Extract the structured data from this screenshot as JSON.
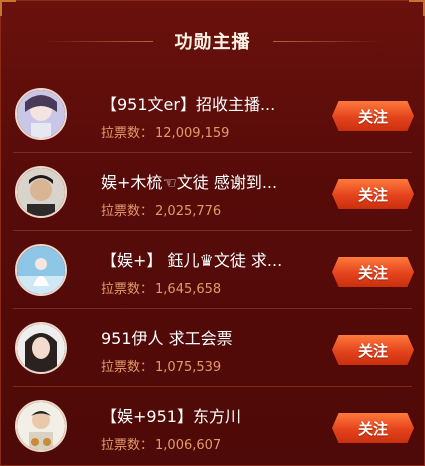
{
  "header": {
    "title": "功勋主播"
  },
  "accent": "#e4431c",
  "hosts": [
    {
      "name": "【951文er】招收主播...",
      "vote_label": "拉票数：",
      "votes": "12,009,159",
      "follow_label": "关注"
    },
    {
      "name": "娱+木梳☜文徒 感谢到...",
      "vote_label": "拉票数：",
      "votes": "2,025,776",
      "follow_label": "关注"
    },
    {
      "name": "【娱+】 鈺儿♛文徒 求...",
      "vote_label": "拉票数：",
      "votes": "1,645,658",
      "follow_label": "关注"
    },
    {
      "name": "951伊人 求工会票",
      "vote_label": "拉票数：",
      "votes": "1,075,539",
      "follow_label": "关注"
    },
    {
      "name": "【娱+951】东方川",
      "vote_label": "拉票数：",
      "votes": "1,006,607",
      "follow_label": "关注"
    }
  ]
}
